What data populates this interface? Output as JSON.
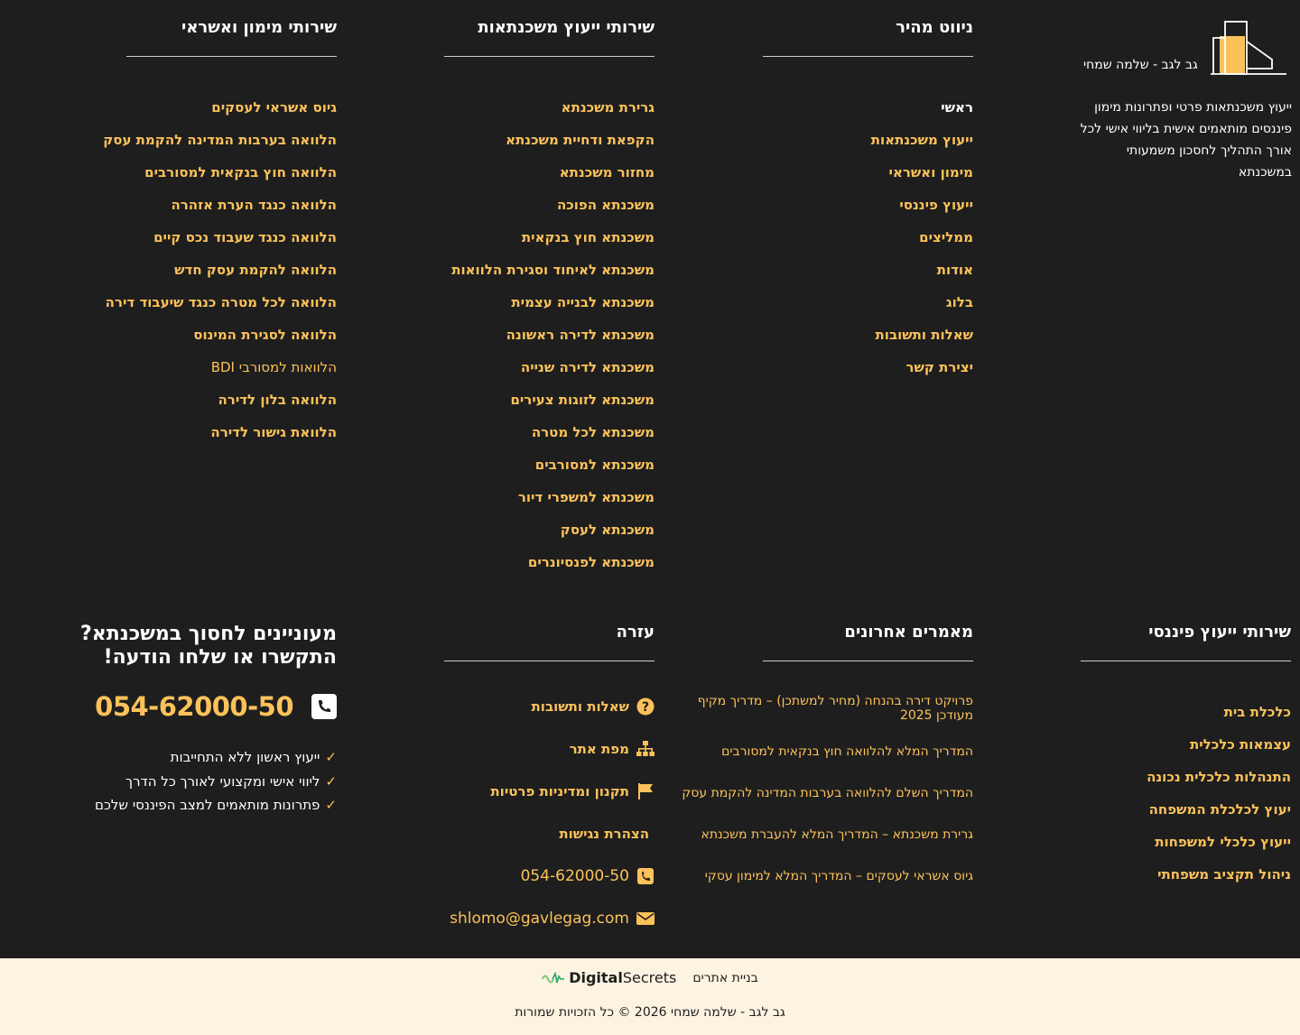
{
  "brand": {
    "logo_text": "גב לגב - שלמה שמחי",
    "about": "ייעוץ משכנתאות פרטי ופתרונות מימון פיננסים מותאמים אישית בליווי אישי לכל אורך התהליך לחסכון משמעותי במשכנתא"
  },
  "quick_nav": {
    "title": "ניווט מהיר",
    "items": [
      "ראשי",
      "ייעוץ משכנתאות",
      "מימון ואשראי",
      "ייעוץ פיננסי",
      "ממליצים",
      "אודות",
      "בלוג",
      "שאלות ותשובות",
      "יצירת קשר"
    ]
  },
  "mortgage_services": {
    "title": "שירותי ייעוץ משכנתאות",
    "items": [
      "גרירת משכנתא",
      "הקפאת ודחיית משכנתא",
      "מחזור משכנתא",
      "משכנתא הפוכה",
      "משכנתא חוץ בנקאית",
      "משכנתא לאיחוד וסגירת הלוואות",
      "משכנתא לבנייה עצמית",
      "משכנתא לדירה ראשונה",
      "משכנתא לדירה שנייה",
      "משכנתא לזוגות צעירים",
      "משכנתא לכל מטרה",
      "משכנתא למסורבים",
      "משכנתא למשפרי דיור",
      "משכנתא לעסק",
      "משכנתא לפנסיונרים"
    ]
  },
  "finance_services": {
    "title": "שירותי מימון ואשראי",
    "items": [
      "גיוס אשראי לעסקים",
      "הלוואה בערבות המדינה להקמת עסק",
      "הלוואה חוץ בנקאית למסורבים",
      "הלוואה כנגד הערת אזהרה",
      "הלוואה כנגד שעבוד נכס קיים",
      "הלוואה להקמת עסק חדש",
      "הלוואה לכל מטרה כנגד שיעבוד דירה",
      "הלוואה לסגירת המינוס",
      "הלוואות למסורבי BDI",
      "הלוואה בלון לדירה",
      "הלוואת גישור לדירה"
    ]
  },
  "financial_advice": {
    "title": "שירותי ייעוץ פיננסי",
    "items": [
      "כלכלת בית",
      "עצמאות כלכלית",
      "התנהלות כלכלית נכונה",
      "יעוץ לכלכלת המשפחה",
      "ייעוץ כלכלי למשפחות",
      "ניהול תקציב משפחתי"
    ]
  },
  "recent_articles": {
    "title": "מאמרים אחרונים",
    "items": [
      "פרויקט דירה בהנחה (מחיר למשתכן) – מדריך מקיף מעודכן 2025",
      "המדריך המלא להלוואה חוץ בנקאית למסורבים",
      "המדריך השלם להלוואה בערבות המדינה להקמת עסק",
      "גרירת משכנתא – המדריך המלא להעברת משכנתא",
      "גיוס אשראי לעסקים – המדריך המלא למימון עסקי"
    ]
  },
  "help": {
    "title": "עזרה",
    "items": [
      {
        "label": "שאלות ותשובות",
        "icon": "question-circle-icon"
      },
      {
        "label": "מפת אתר",
        "icon": "sitemap-icon"
      },
      {
        "label": "תקנון ומדיניות פרטיות",
        "icon": "flag-icon"
      },
      {
        "label": "הצהרת נגישות",
        "icon": ""
      },
      {
        "label": "054-62000-50",
        "icon": "phone-square-icon"
      },
      {
        "label": "shlomo@gavlegag.com",
        "icon": "envelope-icon"
      }
    ]
  },
  "contact": {
    "title_line1": "מעוניינים לחסוך במשכנתא?",
    "title_line2": "התקשרו או שלחו הודעה!",
    "phone": "054-62000-50",
    "bullets": [
      "ייעוץ ראשון ללא התחייבות",
      "ליווי אישי ומקצועי לאורך כל הדרך",
      "פתרונות מותאמים למצב הפיננסי שלכם"
    ]
  },
  "footer": {
    "built_by": "בניית אתרים",
    "digital": "Digital",
    "secrets": "Secrets",
    "copyright": "גב לגב - שלמה שמחי 2026 © כל הזכויות שמורות"
  },
  "colors": {
    "accent": "#fcc25a",
    "background": "#1e1e1e",
    "footer_bg": "#fdf3e1"
  }
}
